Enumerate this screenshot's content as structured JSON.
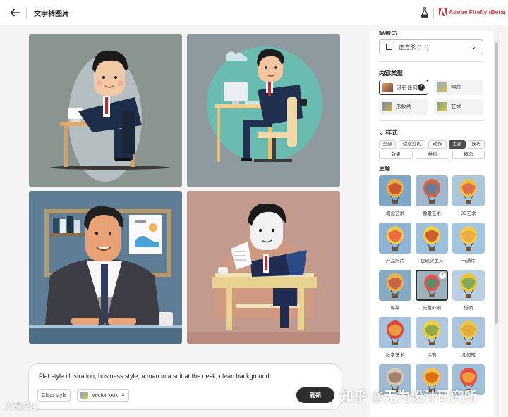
{
  "header": {
    "title": "文字转图片",
    "brand": "Adobe Firefly (Beta)",
    "back_icon": "arrow-left-icon",
    "labs_icon": "flask-icon",
    "brand_color": "#d7373f"
  },
  "results": [
    {
      "label": "businessman-at-desk-grey"
    },
    {
      "label": "businessman-at-computer-teal"
    },
    {
      "label": "businessman-portrait-office"
    },
    {
      "label": "businessman-reading-paper-pink"
    }
  ],
  "prompt": {
    "text": "Flat style illustration, business style, a man in a suit at the desk, clean background",
    "chips": [
      {
        "label": "Clear style"
      },
      {
        "label": "Vector look",
        "remove": "×"
      }
    ],
    "refresh_label": "刷新"
  },
  "panel": {
    "aspect_ratio_title": "纵横比",
    "aspect_ratio_value": "正方形 (1:1)",
    "content_type_title": "内容类型",
    "content_types": [
      {
        "label": "没有任何",
        "selected": true
      },
      {
        "label": "照片",
        "selected": false
      },
      {
        "label": "形象的",
        "selected": false
      },
      {
        "label": "艺术",
        "selected": false
      }
    ],
    "styles_title": "样式",
    "style_tabs": [
      {
        "label": "全部",
        "active": false
      },
      {
        "label": "受欢迎的",
        "active": false
      },
      {
        "label": "动作",
        "active": false
      },
      {
        "label": "主题",
        "active": true
      },
      {
        "label": "技巧",
        "active": false
      },
      {
        "label": "效果",
        "active": false
      },
      {
        "label": "材料",
        "active": false
      },
      {
        "label": "概念",
        "active": false
      }
    ],
    "theme_title": "主题",
    "themes": [
      {
        "label": "概念艺术",
        "selected": false
      },
      {
        "label": "像素艺术",
        "selected": false
      },
      {
        "label": "3D艺术",
        "selected": false
      },
      {
        "label": "产品照片",
        "selected": false
      },
      {
        "label": "超现实主义",
        "selected": false
      },
      {
        "label": "卡通片",
        "selected": false
      },
      {
        "label": "邮票",
        "selected": false
      },
      {
        "label": "矢量外观",
        "selected": true
      },
      {
        "label": "低聚",
        "selected": false
      },
      {
        "label": "数字艺术",
        "selected": false
      },
      {
        "label": "涂鸦",
        "selected": false
      },
      {
        "label": "几何的",
        "selected": false
      },
      {
        "label": "",
        "selected": false
      },
      {
        "label": "",
        "selected": false
      },
      {
        "label": "",
        "selected": false
      }
    ]
  },
  "watermark": {
    "right": "知乎 @无为设计研究所",
    "left": "大数跨境"
  }
}
